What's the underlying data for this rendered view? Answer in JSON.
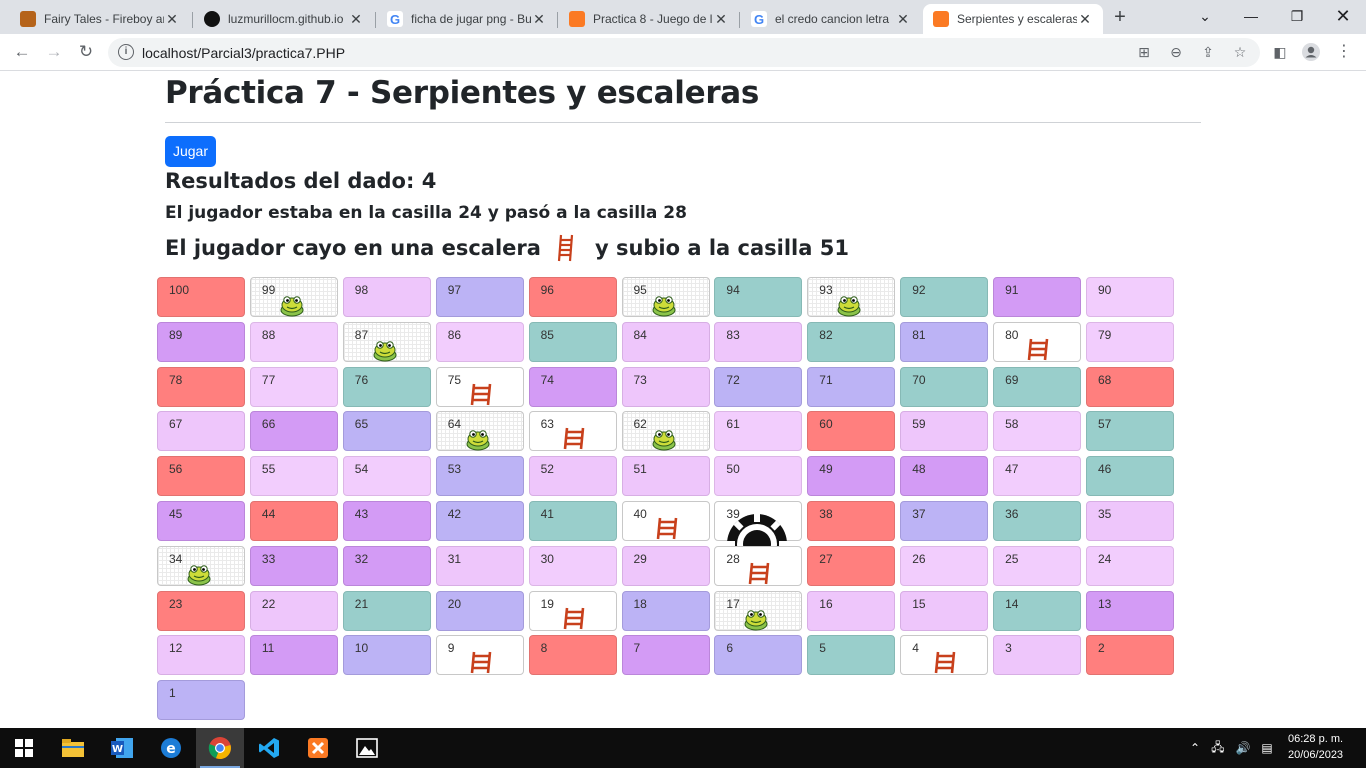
{
  "browser": {
    "tabs": [
      {
        "title": "Fairy Tales - Fireboy and",
        "icon": "fireboy-icon",
        "color": "#b5631a"
      },
      {
        "title": "luzmurillocm.github.io",
        "icon": "github-icon",
        "color": "#111111"
      },
      {
        "title": "ficha de jugar png - Bu",
        "icon": "google-icon",
        "color": "#4285f4"
      },
      {
        "title": "Practica 8 - Juego de l",
        "icon": "xampp-icon",
        "color": "#fb7a24"
      },
      {
        "title": "el credo cancion letra",
        "icon": "google-icon",
        "color": "#4285f4"
      },
      {
        "title": "Serpientes y escaleras",
        "icon": "xampp-icon",
        "color": "#fb7a24",
        "active": true
      }
    ],
    "url": "localhost/Parcial3/practica7.PHP"
  },
  "page": {
    "title": "Práctica 7 - Serpientes y escaleras",
    "play_button": "Jugar",
    "dice_result": "Resultados del dado: 4",
    "move_text": "El jugador estaba en la casilla 24 y pasó a la casilla 28",
    "event_prefix": "El jugador cayo en una escalera",
    "event_suffix": "y subio a la casilla 51"
  },
  "board": {
    "rows": [
      [
        [
          "100",
          "red"
        ],
        [
          "99",
          "check",
          "frog"
        ],
        [
          "98",
          "pink"
        ],
        [
          "97",
          "lav"
        ],
        [
          "96",
          "red"
        ],
        [
          "95",
          "check",
          "frog"
        ],
        [
          "94",
          "teal"
        ],
        [
          "93",
          "check",
          "frog"
        ],
        [
          "92",
          "teal"
        ],
        [
          "91",
          "purp"
        ],
        [
          "90",
          "lpink"
        ]
      ],
      [
        [
          "89",
          "purp"
        ],
        [
          "88",
          "lpink"
        ],
        [
          "87",
          "check",
          "frog"
        ],
        [
          "86",
          "lpink"
        ],
        [
          "85",
          "teal"
        ],
        [
          "84",
          "pink"
        ],
        [
          "83",
          "pink"
        ],
        [
          "82",
          "teal"
        ],
        [
          "81",
          "lav"
        ],
        [
          "80",
          "white",
          "ladder"
        ],
        [
          "79",
          "lpink"
        ]
      ],
      [
        [
          "78",
          "red"
        ],
        [
          "77",
          "lpink"
        ],
        [
          "76",
          "teal"
        ],
        [
          "75",
          "white",
          "ladder"
        ],
        [
          "74",
          "purp"
        ],
        [
          "73",
          "pink"
        ],
        [
          "72",
          "lav"
        ],
        [
          "71",
          "lav"
        ],
        [
          "70",
          "teal"
        ],
        [
          "69",
          "teal"
        ],
        [
          "68",
          "red"
        ]
      ],
      [
        [
          "67",
          "pink"
        ],
        [
          "66",
          "purp"
        ],
        [
          "65",
          "lav"
        ],
        [
          "64",
          "check",
          "frog"
        ],
        [
          "63",
          "white",
          "ladder"
        ],
        [
          "62",
          "check",
          "frog"
        ],
        [
          "61",
          "lpink"
        ],
        [
          "60",
          "red"
        ],
        [
          "59",
          "pink"
        ],
        [
          "58",
          "lpink"
        ],
        [
          "57",
          "teal"
        ]
      ],
      [
        [
          "56",
          "red"
        ],
        [
          "55",
          "lpink"
        ],
        [
          "54",
          "lpink"
        ],
        [
          "53",
          "lav"
        ],
        [
          "52",
          "pink"
        ],
        [
          "51",
          "pink"
        ],
        [
          "50",
          "lpink"
        ],
        [
          "49",
          "purp"
        ],
        [
          "48",
          "purp"
        ],
        [
          "47",
          "lpink"
        ],
        [
          "46",
          "teal"
        ]
      ],
      [
        [
          "45",
          "purp"
        ],
        [
          "44",
          "red"
        ],
        [
          "43",
          "purp"
        ],
        [
          "42",
          "lav"
        ],
        [
          "41",
          "teal"
        ],
        [
          "40",
          "white",
          "ladder"
        ],
        [
          "39",
          "white",
          "token"
        ],
        [
          "38",
          "red"
        ],
        [
          "37",
          "lav"
        ],
        [
          "36",
          "teal"
        ],
        [
          "35",
          "pink"
        ]
      ],
      [
        [
          "34",
          "check",
          "frog"
        ],
        [
          "33",
          "purp"
        ],
        [
          "32",
          "purp"
        ],
        [
          "31",
          "pink"
        ],
        [
          "30",
          "lpink"
        ],
        [
          "29",
          "pink"
        ],
        [
          "28",
          "white",
          "ladder"
        ],
        [
          "27",
          "red"
        ],
        [
          "26",
          "lpink"
        ],
        [
          "25",
          "lpink"
        ],
        [
          "24",
          "lpink"
        ]
      ],
      [
        [
          "23",
          "red"
        ],
        [
          "22",
          "pink"
        ],
        [
          "21",
          "teal"
        ],
        [
          "20",
          "lav"
        ],
        [
          "19",
          "white",
          "ladder"
        ],
        [
          "18",
          "lav"
        ],
        [
          "17",
          "check",
          "frog"
        ],
        [
          "16",
          "pink"
        ],
        [
          "15",
          "pink"
        ],
        [
          "14",
          "teal"
        ],
        [
          "13",
          "purp"
        ]
      ],
      [
        [
          "12",
          "pink"
        ],
        [
          "11",
          "purp"
        ],
        [
          "10",
          "lav"
        ],
        [
          "9",
          "white",
          "ladder"
        ],
        [
          "8",
          "red"
        ],
        [
          "7",
          "purp"
        ],
        [
          "6",
          "lav"
        ],
        [
          "5",
          "teal"
        ],
        [
          "4",
          "white",
          "ladder"
        ],
        [
          "3",
          "pink"
        ],
        [
          "2",
          "red"
        ]
      ],
      [
        [
          "1",
          "lav"
        ]
      ]
    ]
  },
  "taskbar": {
    "apps": [
      "start-icon",
      "file-explorer-icon",
      "word-icon",
      "edge-icon",
      "chrome-icon",
      "vscode-icon",
      "xampp-icon",
      "photos-icon"
    ],
    "time": "06:28 p. m.",
    "date": "20/06/2023"
  }
}
